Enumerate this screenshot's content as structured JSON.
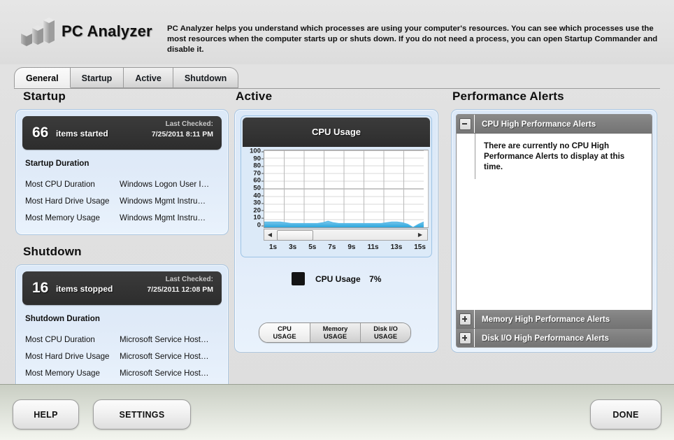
{
  "app": {
    "brand": "PC Analyzer",
    "description": "PC Analyzer helps you understand which processes are using your computer's resources.  You can see which processes use the most resources when the computer starts up or shuts down.  If you do not need a process, you can open Startup Commander and disable it.",
    "logo_icon": "bar-chart-3d-icon"
  },
  "tabs": [
    {
      "label": "General",
      "active": true
    },
    {
      "label": "Startup",
      "active": false
    },
    {
      "label": "Active",
      "active": false
    },
    {
      "label": "Shutdown",
      "active": false
    }
  ],
  "startup": {
    "heading": "Startup",
    "count": "66",
    "count_label": "items started",
    "last_checked_label": "Last Checked:",
    "last_checked_value": "7/25/2011 8:11 PM",
    "duration_heading": "Startup Duration",
    "rows": [
      {
        "key": "Most CPU Duration",
        "value": "Windows Logon User I…"
      },
      {
        "key": "Most Hard Drive Usage",
        "value": "Windows Mgmt Instru…"
      },
      {
        "key": "Most Memory Usage",
        "value": "Windows Mgmt Instru…"
      }
    ]
  },
  "shutdown": {
    "heading": "Shutdown",
    "count": "16",
    "count_label": "items stopped",
    "last_checked_label": "Last Checked:",
    "last_checked_value": "7/25/2011 12:08 PM",
    "duration_heading": "Shutdown Duration",
    "rows": [
      {
        "key": "Most CPU Duration",
        "value": "Microsoft Service Host…"
      },
      {
        "key": "Most Hard Drive Usage",
        "value": "Microsoft Service Host…"
      },
      {
        "key": "Most Memory Usage",
        "value": "Microsoft Service Host…"
      }
    ]
  },
  "active": {
    "heading": "Active",
    "chart_title": "CPU Usage",
    "legend_label": "CPU Usage",
    "legend_value": "7%",
    "legend_color": "#141414",
    "scroll_left_icon": "triangle-left-icon",
    "scroll_right_icon": "triangle-right-icon",
    "buttons": [
      {
        "line1": "CPU",
        "line2": "USAGE",
        "selected": true
      },
      {
        "line1": "Memory",
        "line2": "USAGE",
        "selected": false
      },
      {
        "line1": "Disk I/O",
        "line2": "USAGE",
        "selected": false
      }
    ]
  },
  "alerts": {
    "heading": "Performance Alerts",
    "groups": [
      {
        "title": "CPU High Performance Alerts",
        "expanded": true,
        "toggle_icon": "minus-box-icon",
        "message": "There are currently no CPU High Performance Alerts to display at this time."
      },
      {
        "title": "Memory High Performance Alerts",
        "expanded": false,
        "toggle_icon": "plus-box-icon",
        "message": ""
      },
      {
        "title": "Disk I/O High Performance Alerts",
        "expanded": false,
        "toggle_icon": "plus-box-icon",
        "message": ""
      }
    ]
  },
  "footer": {
    "help": "HELP",
    "settings": "SETTINGS",
    "done": "DONE"
  },
  "chart_data": {
    "type": "area",
    "title": "CPU Usage",
    "xlabel": "",
    "ylabel": "",
    "ylim": [
      0,
      100
    ],
    "yticks": [
      0,
      10,
      20,
      30,
      40,
      50,
      60,
      70,
      80,
      90,
      100
    ],
    "xticks": [
      "1s",
      "3s",
      "5s",
      "7s",
      "9s",
      "11s",
      "13s",
      "15s"
    ],
    "grid": true,
    "legend": "CPU Usage  7%",
    "series": [
      {
        "name": "CPU Usage",
        "color": "#4eb3e4",
        "x": [
          1,
          1.5,
          2,
          2.5,
          3,
          3.5,
          4,
          4.5,
          5,
          5.5,
          6,
          6.5,
          7,
          7.5,
          8,
          8.5,
          9,
          9.5,
          10,
          10.5,
          11,
          11.5,
          12,
          12.5,
          13,
          13.5,
          14,
          14.5,
          15,
          15.5,
          16
        ],
        "values": [
          7,
          7,
          7,
          7,
          6,
          5,
          5,
          5,
          5,
          5,
          5,
          6,
          8,
          6,
          5,
          5,
          5,
          5,
          5,
          5,
          5,
          5,
          5,
          6,
          7,
          7,
          6,
          4,
          0,
          4,
          7
        ]
      }
    ]
  }
}
